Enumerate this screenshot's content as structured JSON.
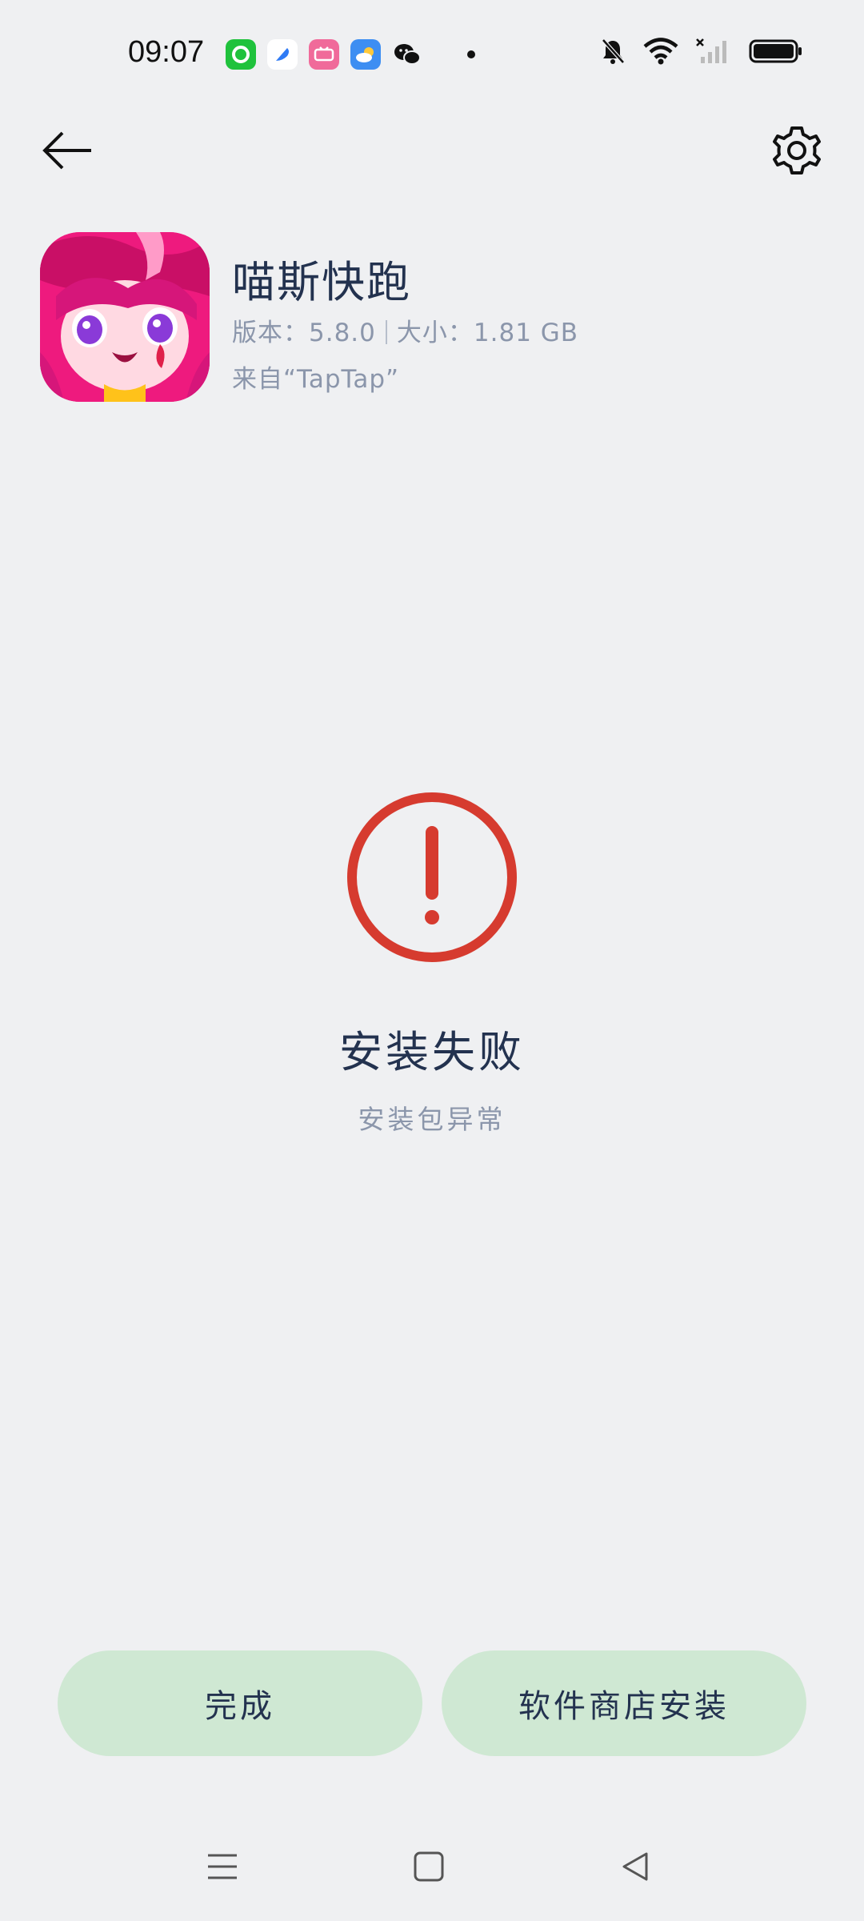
{
  "status_bar": {
    "time": "09:07",
    "notification_icons": [
      "green-app-icon",
      "blue-app-icon",
      "pink-app-icon",
      "weather-icon",
      "wechat-icon"
    ],
    "system_icons": [
      "mute-bell-icon",
      "wifi-icon",
      "no-signal-icon",
      "battery-icon"
    ]
  },
  "toolbar": {
    "back_icon": "arrow-left-icon",
    "settings_icon": "gear-icon"
  },
  "app": {
    "name": "喵斯快跑",
    "version": "版本：5.8.0",
    "size": "大小：1.81 GB",
    "source": "来自“TapTap”"
  },
  "result": {
    "status_icon": "exclamation-circle-icon",
    "title": "安装失败",
    "subtitle": "安装包异常"
  },
  "actions": {
    "done_label": "完成",
    "store_install_label": "软件商店安装"
  },
  "nav_bar": {
    "icons": [
      "menu-icon",
      "home-icon",
      "back-triangle-icon"
    ]
  },
  "colors": {
    "background": "#eff0f2",
    "error": "#d63b2f",
    "button_bg": "#cfe8d3",
    "title_text": "#23324f",
    "meta_text": "#8b96ab"
  }
}
